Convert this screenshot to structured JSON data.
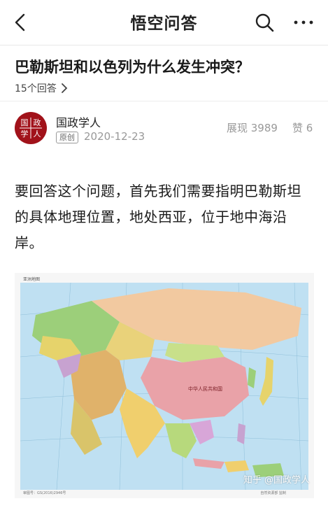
{
  "header": {
    "title": "悟空问答",
    "back_icon": "chevron-left-icon",
    "search_icon": "search-icon",
    "more_icon": "more-dots-icon"
  },
  "question": {
    "title": "巴勒斯坦和以色列为什么发生冲突？",
    "answer_count": "15个回答"
  },
  "author": {
    "name": "国政学人",
    "badge": "原创",
    "date": "2020-12-23",
    "views": "展现 3989",
    "likes": "赞 6",
    "avatar_text": [
      "国",
      "政",
      "学",
      "人"
    ]
  },
  "content": {
    "paragraph": "要回答这个问题，首先我们需要指明巴勒斯坦的具体地理位置，地处西亚，位于地中海沿岸。"
  },
  "map_image": {
    "caption_top": "亚洲地图",
    "footer_left": "审图号：GS(2016)2946号",
    "footer_right": "自然资源部 监制",
    "label_country": "中华人民共和国",
    "watermark": "知乎 @国政学人"
  },
  "colors": {
    "accent_red": "#a1121a",
    "ocean": "#bfe0f2",
    "text_primary": "#1a1a1a",
    "text_muted": "#999999"
  }
}
